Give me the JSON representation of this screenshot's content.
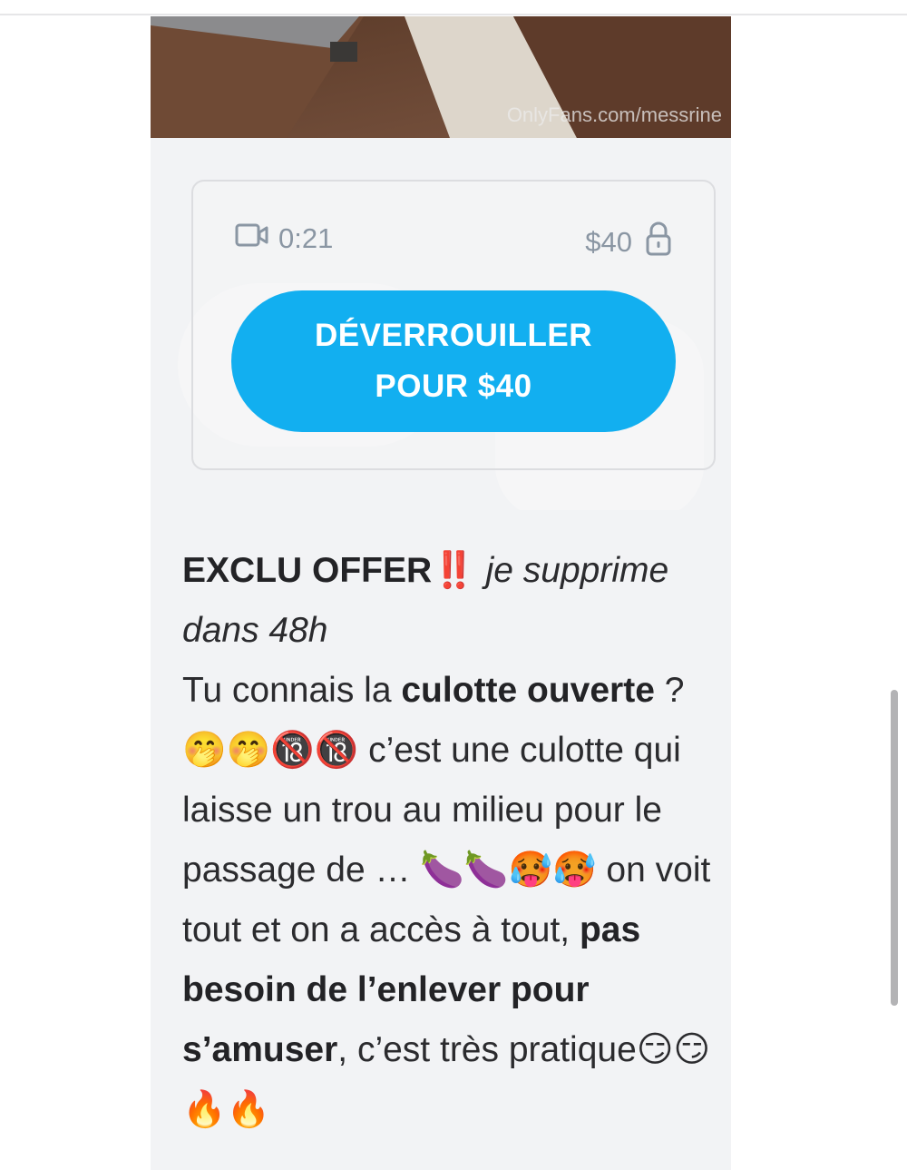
{
  "media": {
    "watermark": "OnlyFans.com/messrine"
  },
  "locked_post": {
    "duration": "0:21",
    "duration_icon": "video-camera-icon",
    "price": "$40",
    "price_icon": "lock-icon",
    "unlock_line1": "DÉVERROUILLER",
    "unlock_line2": "POUR $40"
  },
  "caption": {
    "title": "EXCLU OFFER",
    "title_emoji": "‼️",
    "italic": " je supprime dans 48h",
    "text1": "Tu connais la ",
    "bold1": "culotte ouverte",
    "text2": " ?",
    "emojis1": "🤭🤭🔞🔞",
    "text3": " c’est une culotte qui laisse un trou au milieu pour le passage de … ",
    "emojis2": "🍆🍆🥵🥵",
    "text4": " on voit tout et on a accès à tout, ",
    "bold2": "pas besoin de l’enlever pour s’amuser",
    "text5": ", c’est très pratique",
    "emojis3": "😏😏🔥🔥"
  },
  "colors": {
    "accent": "#12aff0",
    "muted": "#8a96a3",
    "card_bg": "#f2f3f5"
  }
}
